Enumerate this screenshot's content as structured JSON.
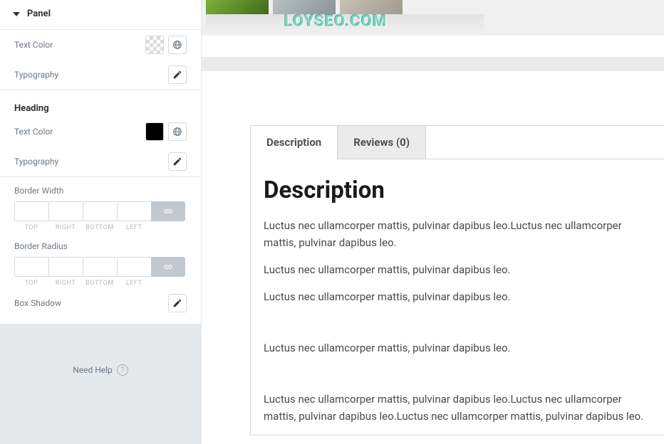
{
  "sidebar": {
    "title": "Panel",
    "panel": {
      "text_color_label": "Text Color",
      "typography_label": "Typography"
    },
    "heading_label": "Heading",
    "heading": {
      "text_color_label": "Text Color",
      "typography_label": "Typography"
    },
    "border_width_label": "Border Width",
    "border_radius_label": "Border Radius",
    "dims": {
      "top": "TOP",
      "right": "RIGHT",
      "bottom": "BOTTOM",
      "left": "LEFT"
    },
    "box_shadow_label": "Box Shadow",
    "help": "Need Help"
  },
  "watermark": "LOYSEO.COM",
  "tabs": {
    "description": "Description",
    "reviews": "Reviews (0)"
  },
  "content": {
    "heading": "Description",
    "p1": "Luctus nec ullamcorper mattis, pulvinar dapibus leo.Luctus nec ullamcorper mattis, pulvinar dapibus leo.",
    "p2": "Luctus nec ullamcorper mattis, pulvinar dapibus leo.",
    "p3": "Luctus nec ullamcorper mattis, pulvinar dapibus leo.",
    "p4": "Luctus nec ullamcorper mattis, pulvinar dapibus leo.",
    "p5": "Luctus nec ullamcorper mattis, pulvinar dapibus leo.Luctus nec ullamcorper mattis, pulvinar dapibus leo.Luctus nec ullamcorper mattis, pulvinar dapibus leo."
  }
}
